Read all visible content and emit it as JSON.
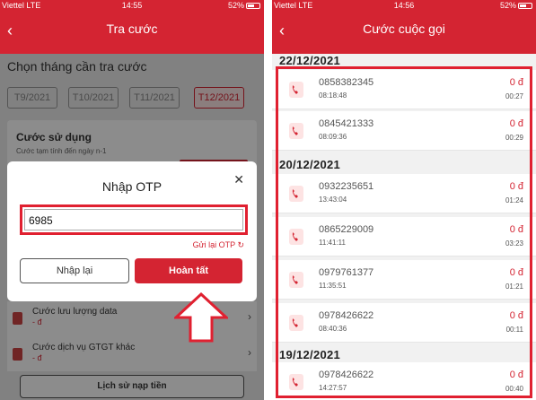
{
  "left": {
    "status": {
      "carrier": "Viettel",
      "network": "LTE",
      "time": "14:55",
      "battery": "52%"
    },
    "title": "Tra cước",
    "choose_label": "Chọn tháng cần tra cước",
    "months": [
      "T9/2021",
      "T10/2021",
      "T11/2021",
      "T12/2021"
    ],
    "usage_title": "Cước sử dụng",
    "usage_sub": "Cước tạm tính đến ngày n-1",
    "list": [
      {
        "name": "Cước lưu lượng data",
        "value": "- đ"
      },
      {
        "name": "Cước dịch vụ GTGT khác",
        "value": "- đ"
      }
    ],
    "history_button": "Lịch sử nạp tiền",
    "modal": {
      "title": "Nhập OTP",
      "otp_value": "6985",
      "resend": "Gửi lại OTP",
      "retry": "Nhập lại",
      "done": "Hoàn tất"
    }
  },
  "right": {
    "status": {
      "carrier": "Viettel",
      "network": "LTE",
      "time": "14:56",
      "battery": "52%"
    },
    "title": "Cước cuộc gọi",
    "groups": [
      {
        "date": "22/12/2021",
        "calls": [
          {
            "number": "0858382345",
            "time": "08:18:48",
            "amount": "0 đ",
            "duration": "00:27"
          },
          {
            "number": "0845421333",
            "time": "08:09:36",
            "amount": "0 đ",
            "duration": "00:29"
          }
        ]
      },
      {
        "date": "20/12/2021",
        "calls": [
          {
            "number": "0932235651",
            "time": "13:43:04",
            "amount": "0 đ",
            "duration": "01:24"
          },
          {
            "number": "0865229009",
            "time": "11:41:11",
            "amount": "0 đ",
            "duration": "03:23"
          },
          {
            "number": "0979761377",
            "time": "11:35:51",
            "amount": "0 đ",
            "duration": "01:21"
          },
          {
            "number": "0978426622",
            "time": "08:40:36",
            "amount": "0 đ",
            "duration": "00:11"
          }
        ]
      },
      {
        "date": "19/12/2021",
        "calls": [
          {
            "number": "0978426622",
            "time": "14:27:57",
            "amount": "0 đ",
            "duration": "00:40"
          }
        ]
      }
    ]
  },
  "colors": {
    "brand": "#d42432",
    "highlight": "#e02030"
  }
}
